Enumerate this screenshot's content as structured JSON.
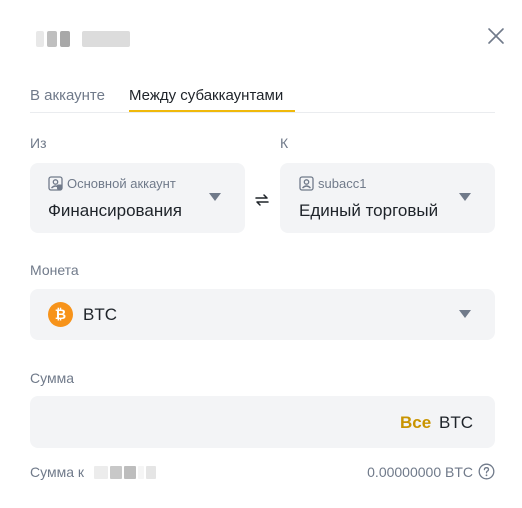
{
  "header": {
    "close_icon": "close-icon"
  },
  "tabs": [
    {
      "label": "В аккаунте",
      "active": false
    },
    {
      "label": "Между субаккаунтами",
      "active": true
    }
  ],
  "colors": {
    "accent": "#f0b90b",
    "accent_text": "#c99400",
    "muted_text": "#707a8a",
    "field_bg": "#f3f4f6",
    "btc": "#f7931a"
  },
  "from": {
    "label": "Из",
    "account_type": "Основной аккаунт",
    "account_name": "Финансирования",
    "icon": "main-account-icon"
  },
  "to": {
    "label": "К",
    "account_type": "subacc1",
    "account_name": "Единый торговый",
    "icon": "subaccount-icon"
  },
  "swap": {
    "icon": "swap-arrows-icon"
  },
  "coin": {
    "label": "Монета",
    "symbol_glyph": "₿",
    "name": "BTC"
  },
  "amount": {
    "label": "Сумма",
    "value": "",
    "all_label": "Все",
    "unit": "BTC"
  },
  "summary": {
    "label": "Сумма к",
    "value": "0.00000000 BTC",
    "help_icon": "question-circle-icon"
  }
}
